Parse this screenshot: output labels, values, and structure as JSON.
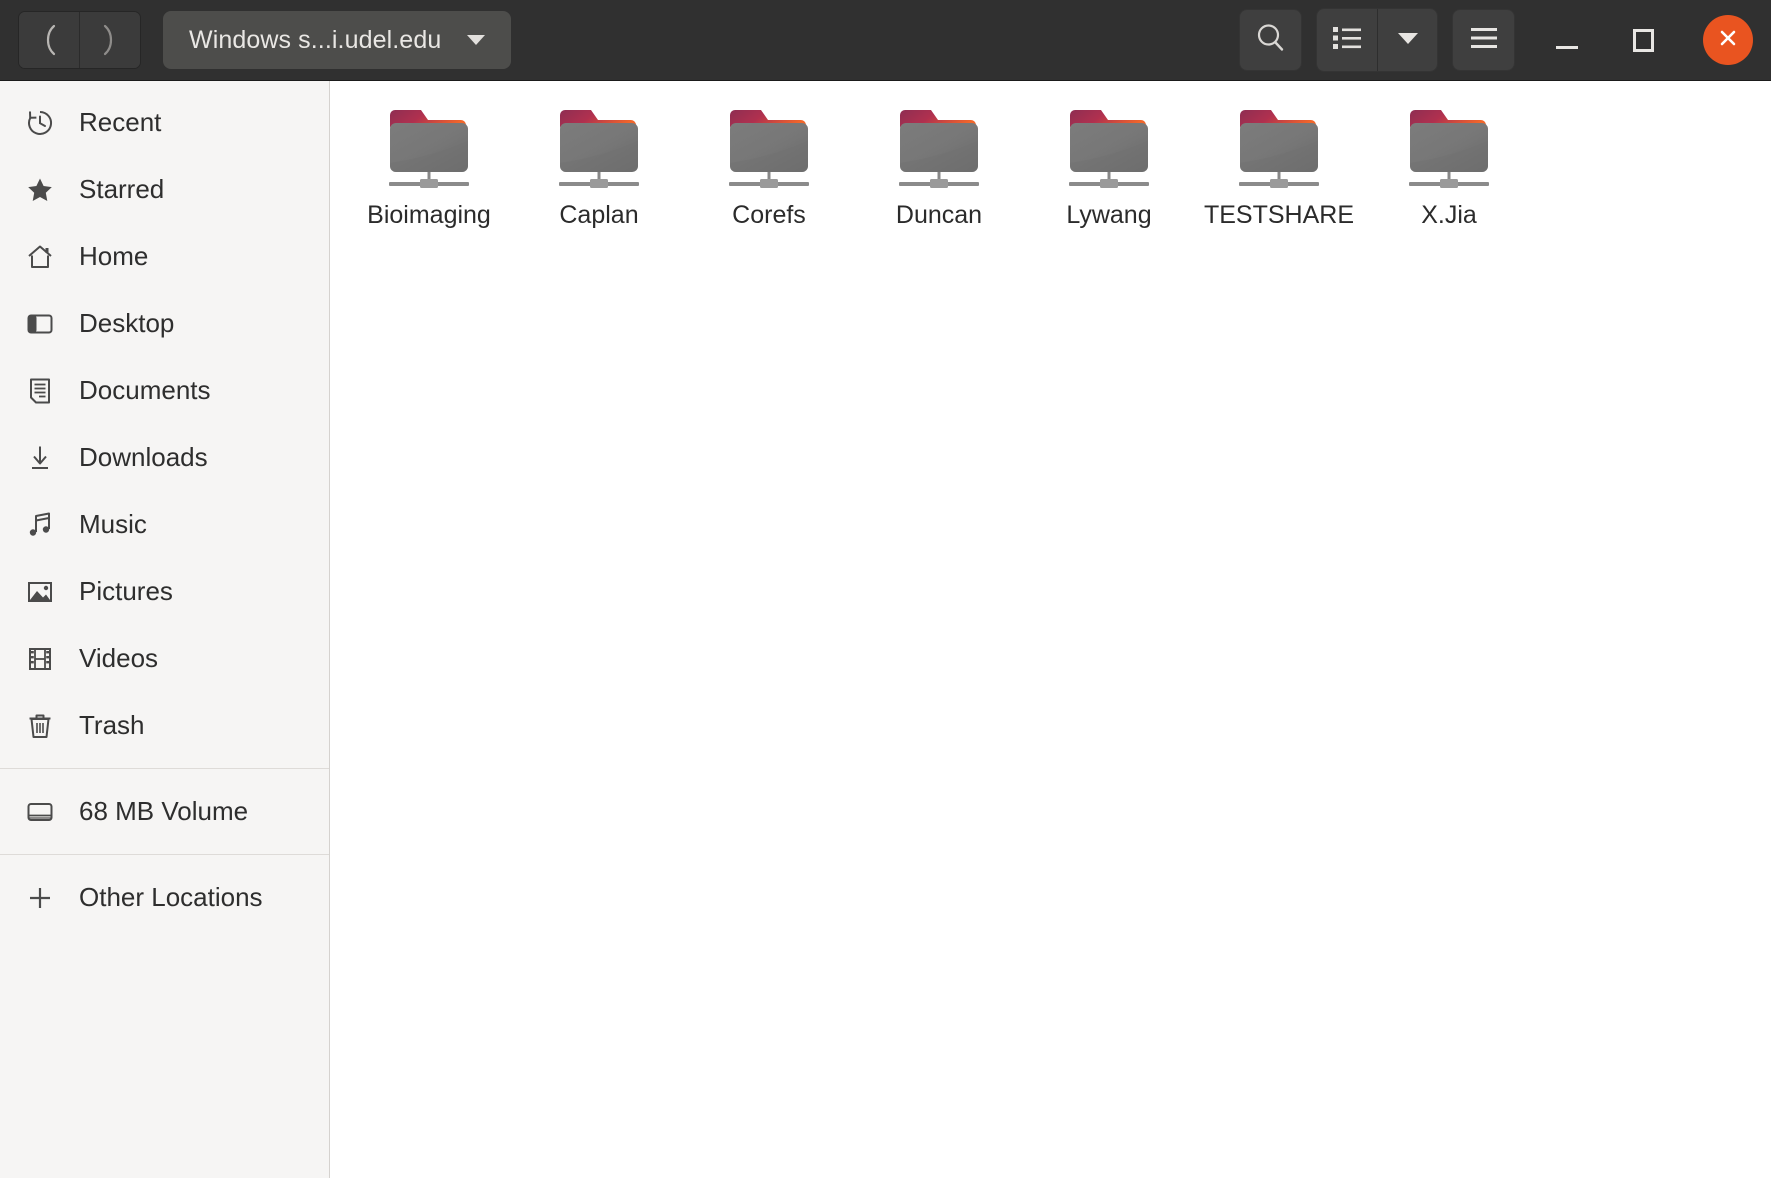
{
  "window": {
    "title": "Windows s...i.udel.edu",
    "accent_close_color": "#e95420",
    "headerbar_color": "#303030",
    "sidebar_color": "#f6f5f4",
    "content_color": "#ffffff"
  },
  "header": {
    "back_icon": "chevron-left-icon",
    "forward_icon": "chevron-right-icon",
    "path_label": "Windows s...i.udel.edu",
    "path_caret_icon": "chevron-down-icon",
    "search_icon": "search-icon",
    "view_list_icon": "list-view-icon",
    "view_caret_icon": "chevron-down-icon",
    "menu_icon": "hamburger-menu-icon",
    "minimize_icon": "minimize-icon",
    "maximize_icon": "maximize-icon",
    "close_icon": "close-icon"
  },
  "sidebar": {
    "items": [
      {
        "label": "Recent",
        "icon": "clock-icon"
      },
      {
        "label": "Starred",
        "icon": "star-icon"
      },
      {
        "label": "Home",
        "icon": "home-icon"
      },
      {
        "label": "Desktop",
        "icon": "desktop-icon"
      },
      {
        "label": "Documents",
        "icon": "document-icon"
      },
      {
        "label": "Downloads",
        "icon": "download-arrow-icon"
      },
      {
        "label": "Music",
        "icon": "music-note-icon"
      },
      {
        "label": "Pictures",
        "icon": "picture-icon"
      },
      {
        "label": "Videos",
        "icon": "film-icon"
      },
      {
        "label": "Trash",
        "icon": "trash-icon"
      }
    ],
    "volumes": [
      {
        "label": "68 MB Volume",
        "icon": "drive-icon"
      }
    ],
    "other": [
      {
        "label": "Other Locations",
        "icon": "plus-icon"
      }
    ]
  },
  "content": {
    "files": [
      {
        "name": "Bioimaging",
        "icon": "remote-folder-icon"
      },
      {
        "name": "Caplan",
        "icon": "remote-folder-icon"
      },
      {
        "name": "Corefs",
        "icon": "remote-folder-icon"
      },
      {
        "name": "Duncan",
        "icon": "remote-folder-icon"
      },
      {
        "name": "Lywang",
        "icon": "remote-folder-icon"
      },
      {
        "name": "TESTSHARE",
        "icon": "remote-folder-icon"
      },
      {
        "name": "X.Jia",
        "icon": "remote-folder-icon"
      }
    ]
  }
}
